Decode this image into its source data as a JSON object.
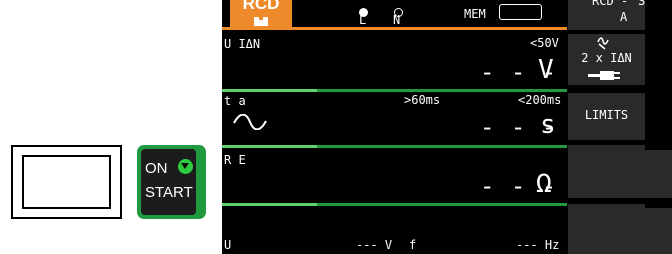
{
  "on_start": {
    "on": "ON",
    "start": "START",
    "arrow_icon": "triangle-down-icon"
  },
  "display": {
    "mode_tab": "RCD",
    "probe_l": "L",
    "probe_n": "N",
    "mem_label": "MEM",
    "colors": {
      "accent": "#ee8a2a",
      "divider": "#1f9a3e",
      "background": "#000000"
    },
    "rows": [
      {
        "param": "U IΔN",
        "limit_right": "<50V",
        "value": "- - -",
        "unit": "V"
      },
      {
        "param": "t a",
        "limit_left": ">60ms",
        "limit_right": "<200ms",
        "value": "- - -",
        "unit": "s",
        "icon": "sine-wave-icon"
      },
      {
        "param": "R E",
        "value": "- - -",
        "unit": "Ω"
      }
    ],
    "footer": {
      "u_label": "U",
      "v_value": "--- V",
      "f_label": "f",
      "hz_value": "--- Hz"
    }
  },
  "softkeys": {
    "key1": {
      "line1": "RCD -",
      "line1b": "S",
      "line2": "A"
    },
    "key2": {
      "icon": "wave-arrow-icon",
      "label": "2 x IΔN",
      "plug_icon": "plug-icon"
    },
    "key3": {
      "label": "LIMITS"
    }
  }
}
